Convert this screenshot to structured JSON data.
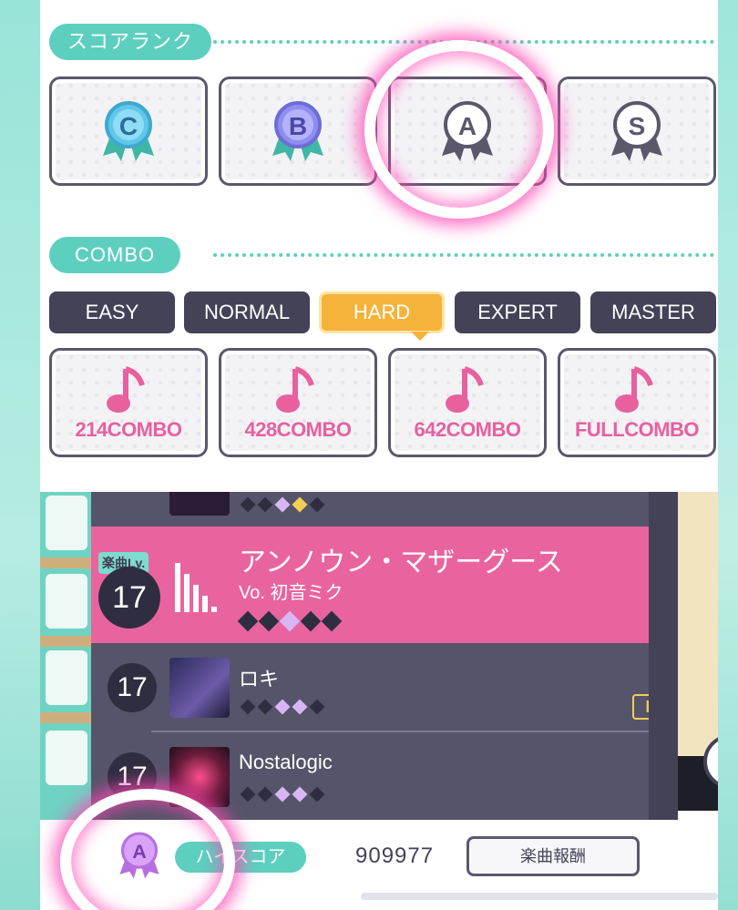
{
  "score_rank": {
    "section_label": "スコアランク",
    "tiles": [
      {
        "letter": "C",
        "color": "#5fc8e8"
      },
      {
        "letter": "B",
        "color": "#8f8ef0"
      },
      {
        "letter": "A",
        "color": "#ffffff"
      },
      {
        "letter": "S",
        "color": "#ffffff"
      }
    ]
  },
  "combo": {
    "section_label": "COMBO",
    "difficulties": [
      {
        "label": "EASY",
        "active": false
      },
      {
        "label": "NORMAL",
        "active": false
      },
      {
        "label": "HARD",
        "active": true
      },
      {
        "label": "EXPERT",
        "active": false
      },
      {
        "label": "MASTER",
        "active": false
      }
    ],
    "rewards": [
      {
        "label": "214COMBO"
      },
      {
        "label": "428COMBO"
      },
      {
        "label": "642COMBO"
      },
      {
        "label": "FULLCOMBO"
      }
    ],
    "accent_color": "#f5b33b"
  },
  "song_list": {
    "selected": {
      "level_tag": "楽曲Lv.",
      "level": "17",
      "title": "アンノウン・マザーグース",
      "vocalist": "Vo. 初音ミク"
    },
    "songs": [
      {
        "level": "17",
        "title": "ロキ",
        "badge": "MV"
      },
      {
        "level": "17",
        "title": "Nostalogic"
      }
    ]
  },
  "bottom_bar": {
    "rank_letter": "A",
    "high_score_label": "ハイスコア",
    "score": "909977",
    "reward_button": "楽曲報酬"
  },
  "colors": {
    "teal": "#5dcfbf",
    "pink": "#e9649f",
    "dark": "#434257",
    "highlight": "#ff46b4"
  }
}
